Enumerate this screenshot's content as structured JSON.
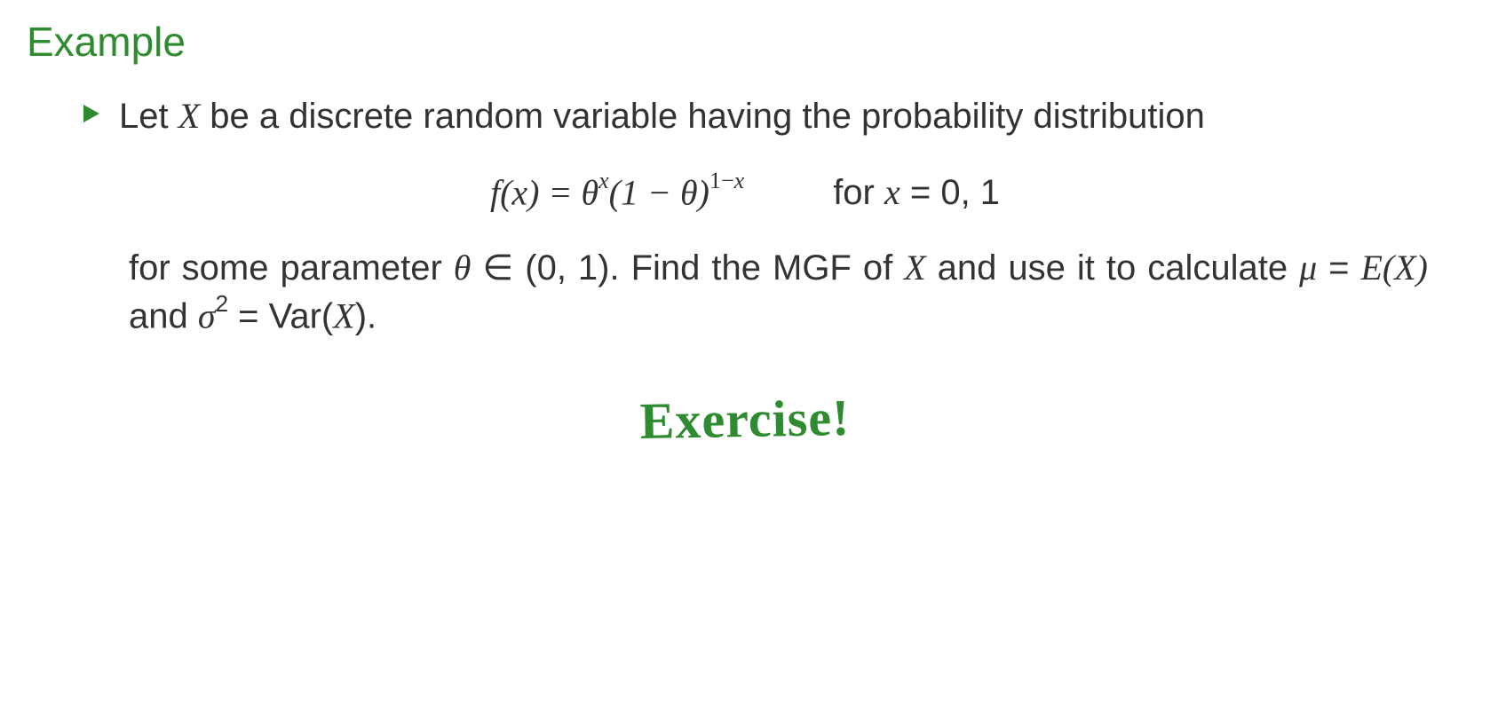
{
  "heading": "Example",
  "bullet": {
    "intro": "Let X be a discrete random variable having the probability distribution"
  },
  "equation": {
    "func_name": "f",
    "arg": "x",
    "base1": "θ",
    "exp1": "x",
    "lparen": "(1 − ",
    "base2": "θ",
    "rparen": ")",
    "exp2": "1−x",
    "cond_prefix": "for ",
    "cond_var": "x",
    "cond_eq": " = 0, 1"
  },
  "followup": {
    "part1": "for some parameter ",
    "theta": "θ",
    "in": " ∈ (0, 1). Find the MGF of ",
    "X": "X",
    "part2": " and use it to calculate ",
    "mu": "μ",
    "eq1": " = ",
    "EX": "E(X)",
    "and": " and ",
    "sigma": "σ",
    "sq": "2",
    "eq2": " = Var(",
    "X2": "X",
    "close": ")."
  },
  "handwriting": "Exercise!"
}
